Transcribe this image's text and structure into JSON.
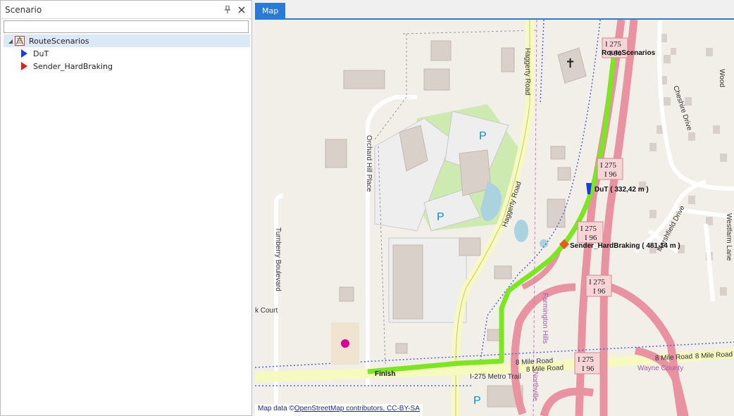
{
  "scenario_panel": {
    "title": "Scenario",
    "pin_icon": "pin-icon",
    "close_icon": "close-icon",
    "search": {
      "value": "",
      "placeholder": ""
    },
    "tree": [
      {
        "label": "RouteScenarios",
        "icon": "route-scenario-icon",
        "selected": true,
        "level": 0
      },
      {
        "label": "DuT",
        "icon": "blue-flag-icon",
        "color": "#1a3fd8",
        "level": 1
      },
      {
        "label": "Sender_HardBraking",
        "icon": "red-flag-icon",
        "color": "#e02020",
        "level": 1
      }
    ]
  },
  "map_tab": {
    "label": "Map",
    "accent": "#2a7bd6"
  },
  "map": {
    "route_color": "#7ce620",
    "labels": {
      "start": "RouteScenarios",
      "dut": "DuT ( 332,42 m )",
      "sender": "Sender_HardBraking ( 481,14 m )",
      "finish": "Finish"
    },
    "street_labels": {
      "haggerty": "Haggerty Road",
      "orchard": "Orchard Hill Place",
      "turnberry": "Turnberry Boulevard",
      "court": "k Court",
      "mile8_a": "8 Mile Road",
      "mile8_b": "8 Mile Road",
      "mile8_c": "8 Mile Road",
      "mile8_d": "8 Mile Road",
      "metro": "I-275 Metro Trail",
      "farmington": "Farmington Hills",
      "wayne": "Wayne County",
      "northville": "Northville",
      "cheshire": "Cheshire Drive",
      "marshfield": "Marshfield Drive",
      "westfarm": "Westfarm Lane",
      "wood": "Wood"
    },
    "shields": [
      {
        "line1": "I 275",
        "line2": "I 96"
      },
      {
        "line1": "I 275",
        "line2": "I 96"
      },
      {
        "line1": "I 275",
        "line2": "I 96"
      },
      {
        "line1": "I 275",
        "line2": "I 96"
      },
      {
        "line1": "I 275",
        "line2": "I 96"
      }
    ],
    "parking": "P",
    "attribution_prefix": "Map data ©",
    "attribution_link": "OpenStreetMap contributors, CC-BY-SA"
  }
}
